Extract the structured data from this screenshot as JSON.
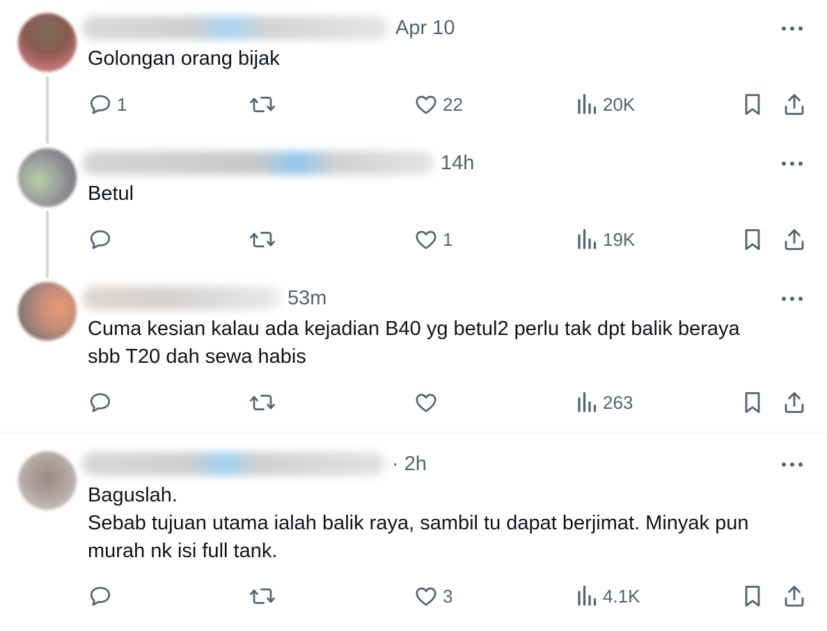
{
  "tweets": [
    {
      "time": "Apr 10",
      "text": [
        "Golongan orang bijak"
      ],
      "replies": "1",
      "retweets": "",
      "likes": "22",
      "views": "20K"
    },
    {
      "time": "14h",
      "text": [
        "Betul"
      ],
      "replies": "",
      "retweets": "",
      "likes": "1",
      "views": "19K"
    },
    {
      "time": "53m",
      "text": [
        "Cuma kesian kalau ada kejadian B40 yg betul2 perlu tak dpt balik beraya",
        "sbb T20 dah sewa habis"
      ],
      "replies": "",
      "retweets": "",
      "likes": "",
      "views": "263"
    },
    {
      "time": "· 2h",
      "text": [
        "Baguslah.",
        "Sebab tujuan utama ialah balik raya, sambil tu dapat berjimat. Minyak pun",
        "murah nk isi full tank."
      ],
      "replies": "",
      "retweets": "",
      "likes": "3",
      "views": "4.1K"
    }
  ],
  "icons": {
    "reply": "reply-icon",
    "retweet": "retweet-icon",
    "like": "heart-icon",
    "views": "views-icon",
    "bookmark": "bookmark-icon",
    "share": "share-icon",
    "more": "more-icon"
  },
  "colors": {
    "text": "#0f1419",
    "muted": "#536471",
    "thread_line": "#cfd9de",
    "divider": "#eff3f4"
  }
}
